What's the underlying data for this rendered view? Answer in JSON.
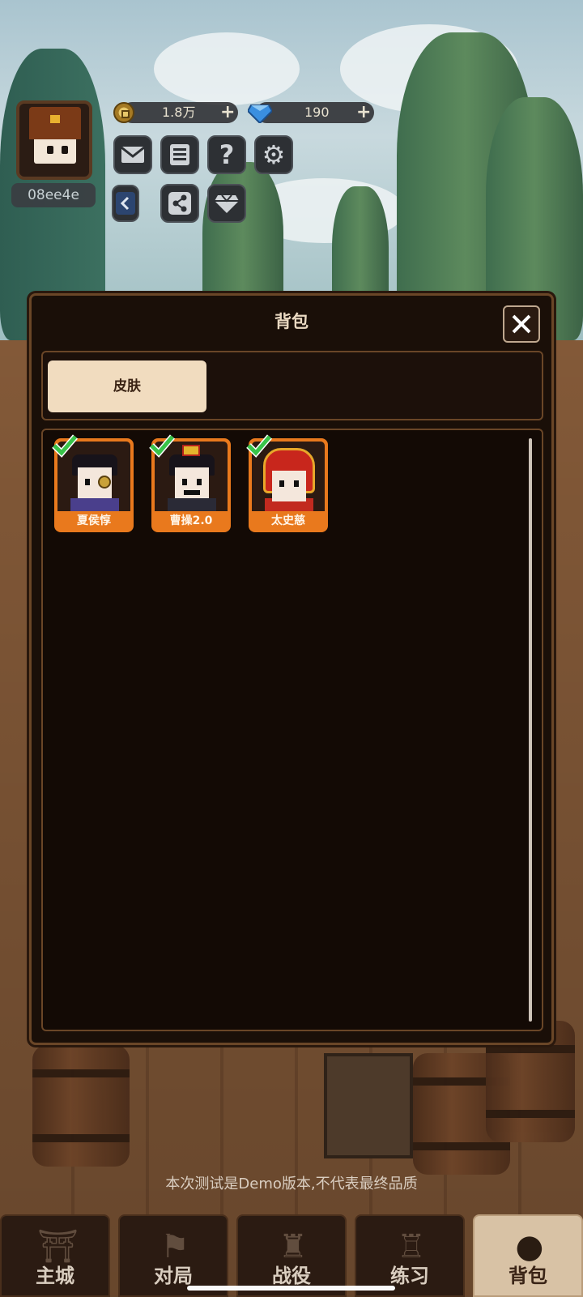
{
  "player": {
    "id": "08ee4e"
  },
  "resources": {
    "coins": {
      "value": "1.8万",
      "icon": "coin-icon"
    },
    "gems": {
      "value": "190",
      "icon": "diamond-icon"
    }
  },
  "hud_buttons": [
    "mail-icon",
    "notice-icon",
    "help-icon",
    "settings-icon",
    "collapse-arrow-icon",
    "share-icon",
    "diamond-shop-icon"
  ],
  "panel": {
    "title": "背包",
    "tabs": [
      {
        "label": "皮肤"
      }
    ],
    "items": [
      {
        "name": "夏侯惇",
        "owned": true
      },
      {
        "name": "曹操2.0",
        "owned": true
      },
      {
        "name": "太史慈",
        "owned": true
      }
    ]
  },
  "footer_note": "本次测试是Demo版本,不代表最终品质",
  "nav": [
    {
      "label": "主城",
      "icon": "castle-icon",
      "active": false
    },
    {
      "label": "对局",
      "icon": "battle-flag-icon",
      "active": false
    },
    {
      "label": "战役",
      "icon": "campaign-helmet-icon",
      "active": false
    },
    {
      "label": "练习",
      "icon": "training-dummy-icon",
      "active": false
    },
    {
      "label": "背包",
      "icon": "bag-icon",
      "active": true
    }
  ],
  "colors": {
    "item_border": "#e9791d",
    "active_tab": "#f1dcbf",
    "check": "#39c44a"
  }
}
